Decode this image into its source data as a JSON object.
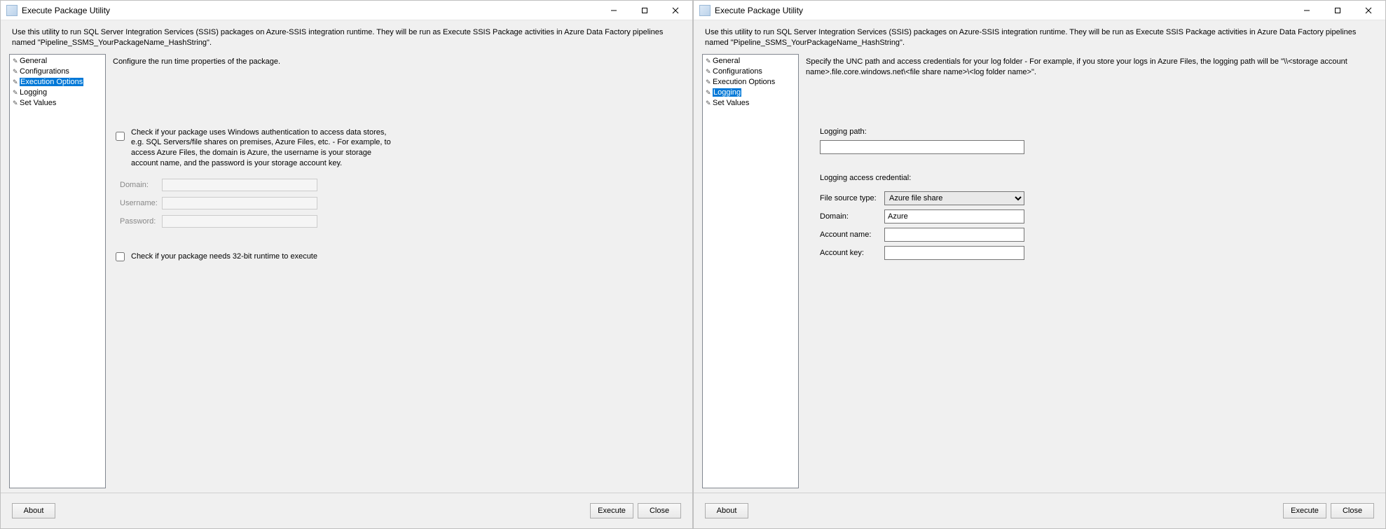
{
  "window_title": "Execute Package Utility",
  "description": "Use this utility to run SQL Server Integration Services (SSIS) packages on Azure-SSIS integration runtime. They will be run as Execute SSIS Package activities in Azure Data Factory pipelines named \"Pipeline_SSMS_YourPackageName_HashString\".",
  "nav": [
    "General",
    "Configurations",
    "Execution Options",
    "Logging",
    "Set Values"
  ],
  "footer": {
    "about": "About",
    "execute": "Execute",
    "close": "Close"
  },
  "left": {
    "selected_nav": "Execution Options",
    "hint": "Configure the run time properties of the package.",
    "cb1_label": "Check if your package uses Windows authentication to access data stores, e.g. SQL Servers/file shares on premises, Azure Files, etc. - For example, to access Azure Files, the domain is Azure, the username is your storage account name, and the password is your storage account key.",
    "cb1_checked": false,
    "domain_label": "Domain:",
    "username_label": "Username:",
    "password_label": "Password:",
    "domain_value": "",
    "username_value": "",
    "password_value": "",
    "fields_disabled": true,
    "cb2_label": "Check if your package needs 32-bit runtime to execute",
    "cb2_checked": false
  },
  "right": {
    "selected_nav": "Logging",
    "hint": "Specify the UNC path and access credentials for your log folder - For example, if you store your logs in Azure Files, the logging path will be \"\\\\<storage account name>.file.core.windows.net\\<file share name>\\<log folder name>\".",
    "logging_path_label": "Logging path:",
    "logging_path_value": "",
    "credential_header": "Logging access credential:",
    "file_source_type_label": "File source type:",
    "file_source_type_value": "Azure file share",
    "domain_label": "Domain:",
    "domain_value": "Azure",
    "account_name_label": "Account name:",
    "account_name_value": "",
    "account_key_label": "Account key:",
    "account_key_value": ""
  }
}
